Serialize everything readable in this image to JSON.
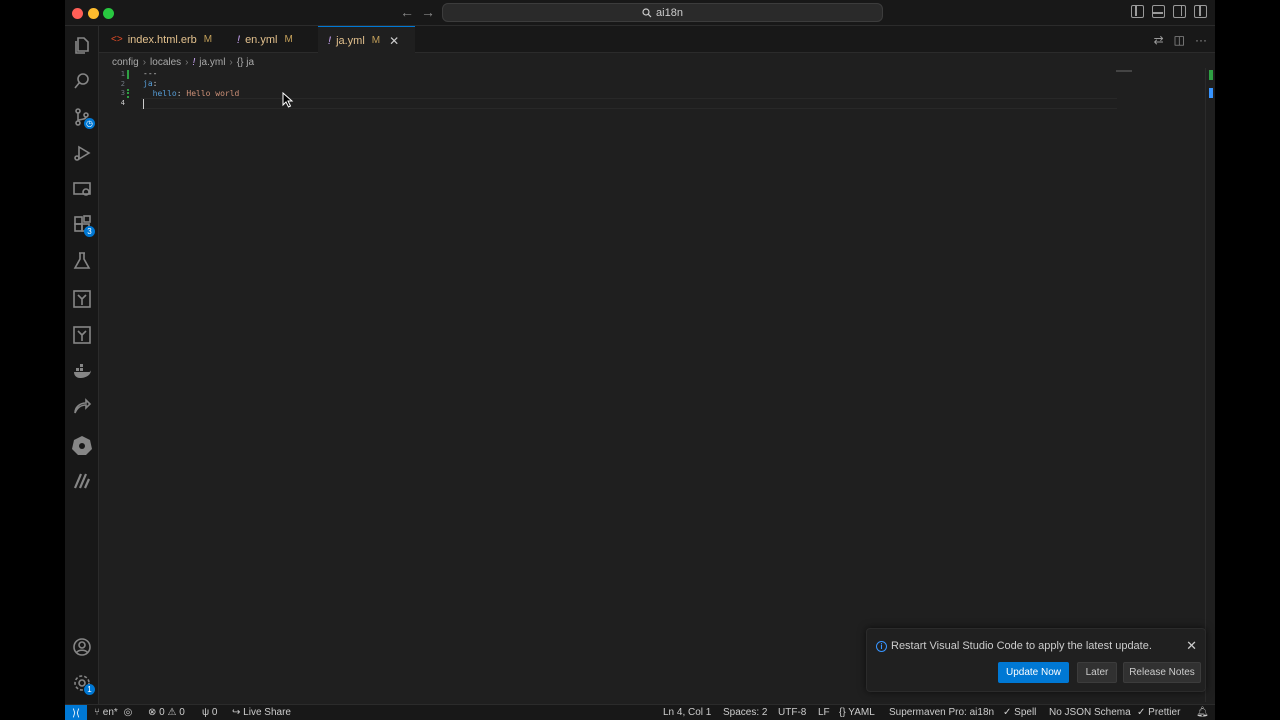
{
  "titlebar": {
    "search_text": "ai18n"
  },
  "activity": {
    "scm_badge": "",
    "extensions_badge": "3",
    "settings_badge": "1"
  },
  "tabs": [
    {
      "label": "index.html.erb",
      "status": "M"
    },
    {
      "label": "en.yml",
      "status": "M"
    },
    {
      "label": "ja.yml",
      "status": "M"
    }
  ],
  "breadcrumb": {
    "part1": "config",
    "part2": "locales",
    "part3": "ja.yml",
    "part4": "{} ja"
  },
  "editor": {
    "line_numbers": [
      "1",
      "2",
      "3",
      "4"
    ],
    "line1": "---",
    "line2_key": "ja",
    "line2_colon": ":",
    "line3_key": "hello",
    "line3_colon": ":",
    "line3_value": "Hello world"
  },
  "notification": {
    "message": "Restart Visual Studio Code to apply the latest update.",
    "update_now": "Update Now",
    "later": "Later",
    "release_notes": "Release Notes"
  },
  "statusbar": {
    "branch": "en*",
    "errors": "0",
    "warnings": "0",
    "ports": "0",
    "live_share": "Live Share",
    "position": "Ln 4, Col 1",
    "spaces": "Spaces: 2",
    "encoding": "UTF-8",
    "eol": "LF",
    "language": "YAML",
    "supermaven": "Supermaven Pro: ai18n",
    "spell": "Spell",
    "json_schema": "No JSON Schema",
    "prettier": "Prettier"
  },
  "colors": {
    "accent": "#0078d4",
    "git_added": "#2ea043",
    "modified": "#e2c08d"
  }
}
